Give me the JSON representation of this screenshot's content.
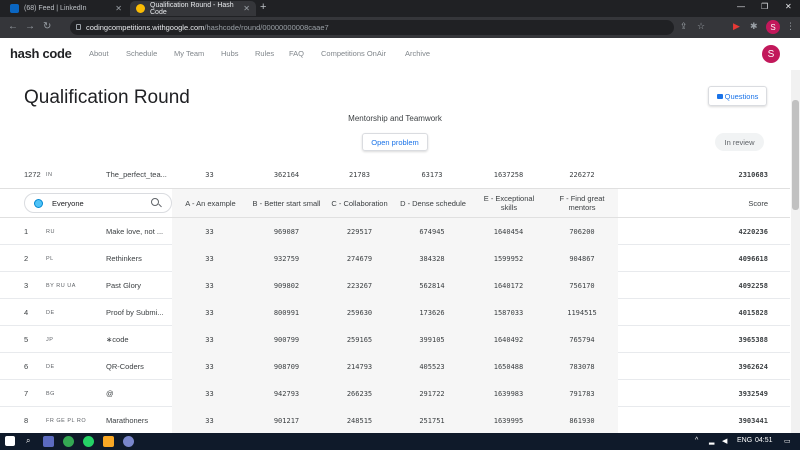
{
  "browser": {
    "tabs": [
      {
        "title": "(68) Feed | LinkedIn",
        "active": false
      },
      {
        "title": "Qualification Round - Hash Code",
        "active": true
      }
    ],
    "url_host": "codingcompetitions.withgoogle.com",
    "url_path": "/hashcode/round/00000000008caae7",
    "profile_initial": "S"
  },
  "app": {
    "logo": "hash code",
    "nav": [
      "About",
      "Schedule",
      "My Team",
      "Hubs",
      "Rules",
      "FAQ",
      "Competitions OnAir",
      "Archive"
    ],
    "avatar_initial": "S"
  },
  "page": {
    "title": "Qualification Round",
    "questions_label": "Questions",
    "problem_title": "Mentorship and Teamwork",
    "open_problem_label": "Open problem",
    "status_label": "In review"
  },
  "my_team": {
    "rank": "1272",
    "countries": "IN",
    "team": "The_perfect_tea...",
    "scores": [
      "33",
      "362164",
      "21783",
      "63173",
      "1637258",
      "226272"
    ],
    "total": "2310683"
  },
  "filter": {
    "value": "Everyone"
  },
  "columns": [
    "A - An example",
    "B - Better start small",
    "C - Collaboration",
    "D - Dense schedule",
    "E - Exceptional skills",
    "F - Find great mentors"
  ],
  "score_header": "Score",
  "rows": [
    {
      "rank": "1",
      "countries": "RU",
      "team": "Make love, not ...",
      "scores": [
        "33",
        "969087",
        "229517",
        "674945",
        "1640454",
        "706200"
      ],
      "total": "4220236"
    },
    {
      "rank": "2",
      "countries": "PL",
      "team": "Rethinkers",
      "scores": [
        "33",
        "932759",
        "274679",
        "384328",
        "1599952",
        "904867"
      ],
      "total": "4096618"
    },
    {
      "rank": "3",
      "countries": "BY  RU  UA",
      "team": "Past Glory",
      "scores": [
        "33",
        "909802",
        "223267",
        "562814",
        "1640172",
        "756170"
      ],
      "total": "4092258"
    },
    {
      "rank": "4",
      "countries": "DE",
      "team": "Proof by Submi...",
      "scores": [
        "33",
        "800991",
        "259630",
        "173626",
        "1587033",
        "1194515"
      ],
      "total": "4015828"
    },
    {
      "rank": "5",
      "countries": "JP",
      "team": "∗code",
      "scores": [
        "33",
        "900799",
        "259165",
        "399105",
        "1640492",
        "765794"
      ],
      "total": "3965388"
    },
    {
      "rank": "6",
      "countries": "DE",
      "team": "QR-Coders",
      "scores": [
        "33",
        "908709",
        "214793",
        "405523",
        "1650488",
        "783078"
      ],
      "total": "3962624"
    },
    {
      "rank": "7",
      "countries": "BG",
      "team": "@",
      "scores": [
        "33",
        "942793",
        "266235",
        "291722",
        "1639983",
        "791783"
      ],
      "total": "3932549"
    },
    {
      "rank": "8",
      "countries": "FR  GE  PL  RO",
      "team": "Marathoners",
      "scores": [
        "33",
        "901217",
        "248515",
        "251751",
        "1639995",
        "861930"
      ],
      "total": "3903441"
    }
  ],
  "taskbar": {
    "lang": "ENG",
    "time": "04:51"
  }
}
